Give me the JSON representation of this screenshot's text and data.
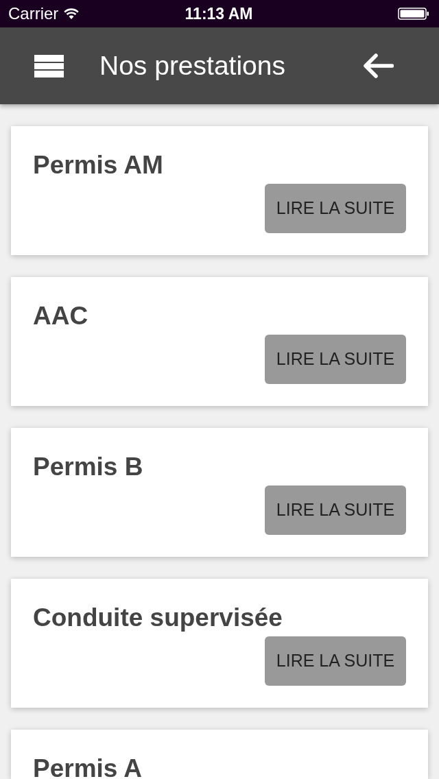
{
  "status_bar": {
    "carrier": "Carrier",
    "time": "11:13 AM"
  },
  "header": {
    "title": "Nos prestations"
  },
  "services": [
    {
      "title": "Permis AM",
      "button": "LIRE LA SUITE"
    },
    {
      "title": "AAC",
      "button": "LIRE LA SUITE"
    },
    {
      "title": "Permis B",
      "button": "LIRE LA SUITE"
    },
    {
      "title": "Conduite supervisée",
      "button": "LIRE LA SUITE"
    },
    {
      "title": "Permis A"
    }
  ]
}
